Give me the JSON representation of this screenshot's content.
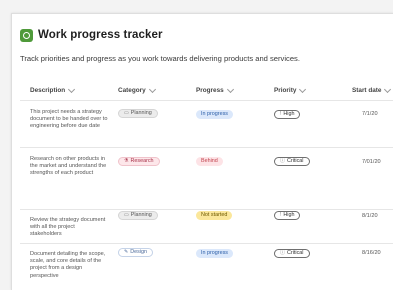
{
  "app": {
    "title": "Work progress tracker",
    "subtitle": "Track priorities and progress as you work towards delivering products and services."
  },
  "columns": {
    "description": "Description",
    "category": "Category",
    "progress": "Progress",
    "priority": "Priority",
    "start_date": "Start date"
  },
  "rows": [
    {
      "description": "This project needs a strategy document to be handed over to engineering before due date",
      "category": "Planning",
      "category_icon": "calendar-icon",
      "progress": "In progress",
      "priority": "High",
      "priority_icon": "exclamation-icon",
      "start_date": "7/1/20"
    },
    {
      "description": "Research on other products in the market and understand the strengths of each product",
      "category": "Research",
      "category_icon": "flask-icon",
      "progress": "Behind",
      "priority": "Critical",
      "priority_icon": "alert-circle-icon",
      "start_date": "7/01/20"
    },
    {
      "description": "Review the strategy document with all the project stakeholders",
      "category": "Planning",
      "category_icon": "calendar-icon",
      "progress": "Not started",
      "priority": "High",
      "priority_icon": "exclamation-icon",
      "start_date": "8/1/20"
    },
    {
      "description": "Document detailing the scope, scale, and core details of the project from a design perspective",
      "category": "Design",
      "category_icon": "pencil-icon",
      "progress": "In progress",
      "priority": "Critical",
      "priority_icon": "alert-circle-icon",
      "start_date": "8/16/20"
    }
  ],
  "colors": {
    "accent": "#4f9a3a",
    "in_progress": "#dbe8fb",
    "behind": "#fde3e6",
    "not_started": "#fbe79b"
  }
}
